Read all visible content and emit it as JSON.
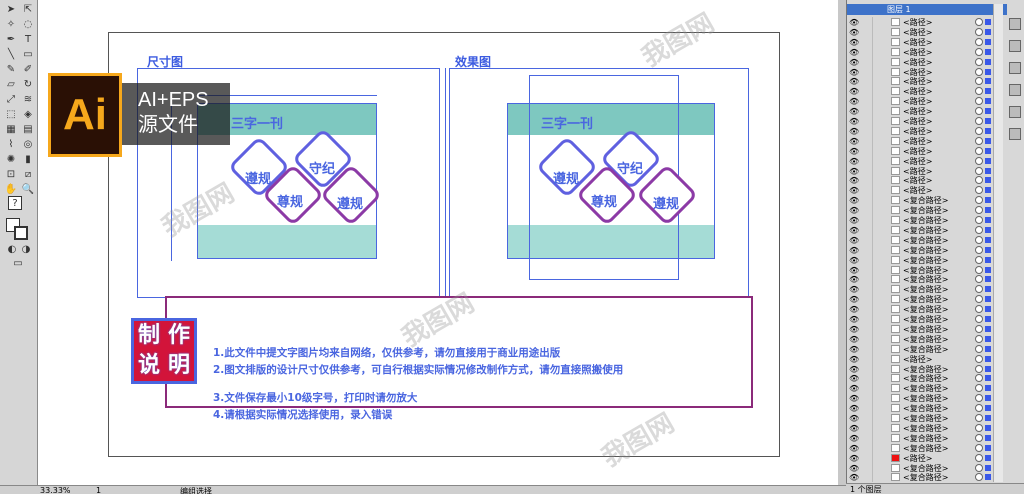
{
  "badge": {
    "logo": "Ai",
    "caption_line1": "AI+EPS",
    "caption_line2": "源文件"
  },
  "artboard": {
    "left_title": "尺寸图",
    "right_title": "效果图",
    "panel_heading": "三字一刊",
    "hex_labels": [
      "遵规",
      "守纪",
      "尊规"
    ],
    "stamp": [
      "制",
      "作",
      "说",
      "明"
    ],
    "desc_lines": [
      "1.此文件中提文字图片均来自网络，仅供参考，请勿直接用于商业用途出版",
      "2.图文排版的设计尺寸仅供参考，可自行根据实际情况修改制作方式，请勿直接照搬使用",
      "3.文件保存最小10级字号，打印时请勿放大",
      "4.请根据实际情况选择使用，录入错误"
    ]
  },
  "layers": {
    "header": "图层 1",
    "rows": [
      "<路径>",
      "<路径>",
      "<路径>",
      "<路径>",
      "<路径>",
      "<路径>",
      "<路径>",
      "<路径>",
      "<路径>",
      "<路径>",
      "<路径>",
      "<路径>",
      "<路径>",
      "<路径>",
      "<路径>",
      "<路径>",
      "<路径>",
      "<路径>",
      "<复合路径>",
      "<复合路径>",
      "<复合路径>",
      "<复合路径>",
      "<复合路径>",
      "<复合路径>",
      "<复合路径>",
      "<复合路径>",
      "<复合路径>",
      "<复合路径>",
      "<复合路径>",
      "<复合路径>",
      "<复合路径>",
      "<复合路径>",
      "<复合路径>",
      "<复合路径>",
      "<路径>",
      "<复合路径>",
      "<复合路径>",
      "<复合路径>",
      "<复合路径>",
      "<复合路径>",
      "<复合路径>",
      "<复合路径>",
      "<复合路径>",
      "<复合路径>",
      "<路径>",
      "<复合路径>",
      "<复合路径>"
    ],
    "red_row_index": 44,
    "footer_count": "1 个图层"
  },
  "status": {
    "zoom": "33.33%",
    "page": "1",
    "mode": "编组选择"
  },
  "watermark": "我图网",
  "colors": {
    "accent": "#4a66e0",
    "teal": "#7ec8c0",
    "stamp_red": "#d2143a",
    "badge_orange": "#f6a81c"
  }
}
